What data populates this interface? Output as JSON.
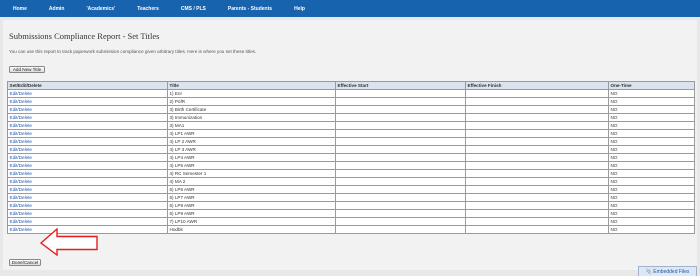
{
  "nav": {
    "items": [
      {
        "label": "Home"
      },
      {
        "label": "Admin"
      },
      {
        "label": "'Academics'"
      },
      {
        "label": "Teachers"
      },
      {
        "label": "CMS / PLS"
      },
      {
        "label": "Parents - Students"
      },
      {
        "label": "Help"
      }
    ]
  },
  "page": {
    "title": "Submissions Compliance Report - Set Titles",
    "description": "You can use this report to track paperwork submission compliance given arbitrary titles. Here is where you set these titles."
  },
  "buttons": {
    "add_new_title": "Add New Title",
    "done_cancel": "Done/Cancel"
  },
  "table": {
    "columns": [
      "Set/Edit/Delete",
      "Title",
      "Effective Start",
      "Effective Finish",
      "One-Time"
    ],
    "rows": [
      {
        "action": "Edit/Delete",
        "title": "1) Enr",
        "start": "",
        "finish": "",
        "one_time": "NO"
      },
      {
        "action": "Edit/Delete",
        "title": "2) PofR",
        "start": "",
        "finish": "",
        "one_time": "NO"
      },
      {
        "action": "Edit/Delete",
        "title": "3) Birth Certificate",
        "start": "",
        "finish": "",
        "one_time": "NO"
      },
      {
        "action": "Edit/Delete",
        "title": "3) Immunization",
        "start": "",
        "finish": "",
        "one_time": "NO"
      },
      {
        "action": "Edit/Delete",
        "title": "3) MA1",
        "start": "",
        "finish": "",
        "one_time": "NO"
      },
      {
        "action": "Edit/Delete",
        "title": "4) LP1 AWR",
        "start": "",
        "finish": "",
        "one_time": "NO"
      },
      {
        "action": "Edit/Delete",
        "title": "4) LP 2 AWR",
        "start": "",
        "finish": "",
        "one_time": "NO"
      },
      {
        "action": "Edit/Delete",
        "title": "4) LP 3 AWR",
        "start": "",
        "finish": "",
        "one_time": "NO"
      },
      {
        "action": "Edit/Delete",
        "title": "4) LP4 AWR",
        "start": "",
        "finish": "",
        "one_time": "NO"
      },
      {
        "action": "Edit/Delete",
        "title": "4) LP5 AWR",
        "start": "",
        "finish": "",
        "one_time": "NO"
      },
      {
        "action": "Edit/Delete",
        "title": "4) RC Semester 1",
        "start": "",
        "finish": "",
        "one_time": "NO"
      },
      {
        "action": "Edit/Delete",
        "title": "4) MA 2",
        "start": "",
        "finish": "",
        "one_time": "NO"
      },
      {
        "action": "Edit/Delete",
        "title": "6) LP6 AWR",
        "start": "",
        "finish": "",
        "one_time": "NO"
      },
      {
        "action": "Edit/Delete",
        "title": "6) LP7 AWR",
        "start": "",
        "finish": "",
        "one_time": "NO"
      },
      {
        "action": "Edit/Delete",
        "title": "6) LP8 AWR",
        "start": "",
        "finish": "",
        "one_time": "NO"
      },
      {
        "action": "Edit/Delete",
        "title": "6) LP9 AWR",
        "start": "",
        "finish": "",
        "one_time": "NO"
      },
      {
        "action": "Edit/Delete",
        "title": "7) LP10 AWR",
        "start": "",
        "finish": "",
        "one_time": "NO"
      },
      {
        "action": "Edit/Delete",
        "title": "Hodbk",
        "start": "",
        "finish": "",
        "one_time": "NO"
      }
    ]
  },
  "annotation": {
    "arrow_color": "#e02020",
    "arrow_fill": "#ffffff"
  },
  "footer": {
    "embedded_files_label": "Embedded Files",
    "embedded_files_icon": "paperclip-icon"
  },
  "colors": {
    "nav_background": "#1863ad",
    "link": "#2255aa",
    "header_background": "#dbe3ef"
  }
}
